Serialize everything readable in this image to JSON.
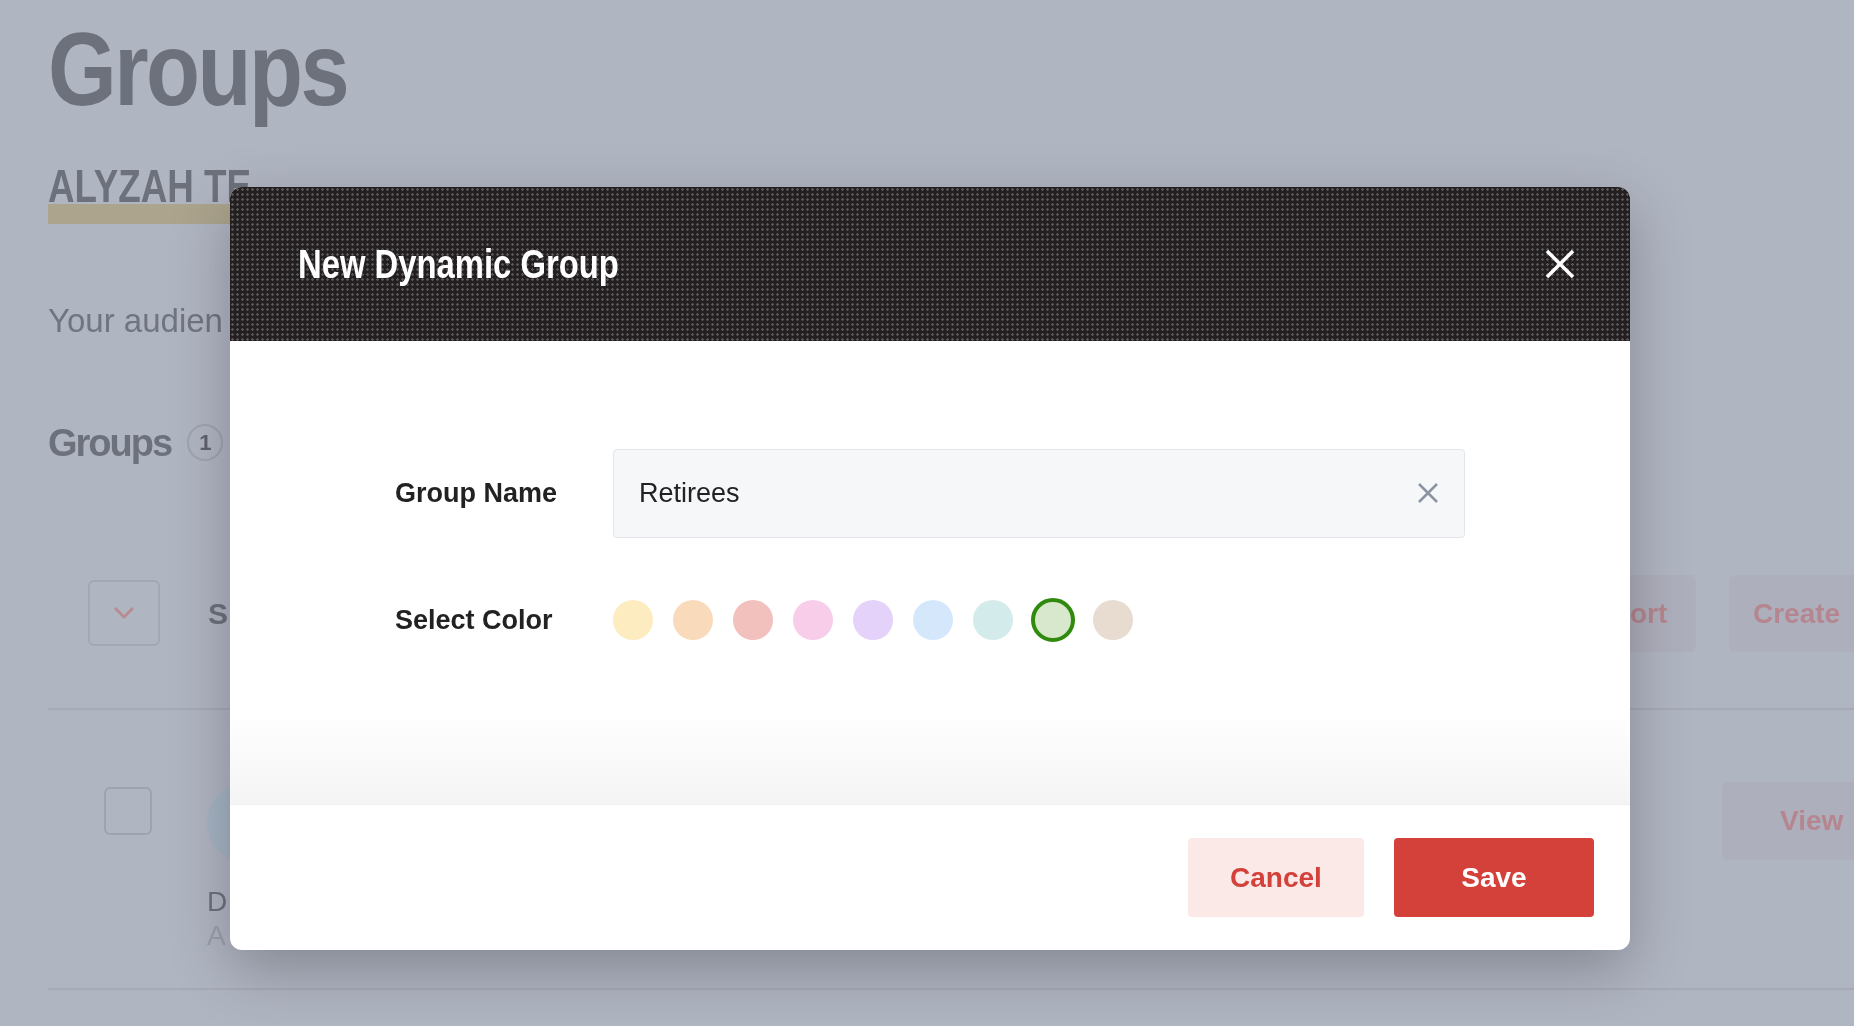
{
  "page": {
    "title": "Groups",
    "company": "ALYZAH TE",
    "intro": "Your audien",
    "section_title": "Groups",
    "count_badge": "1",
    "toolbar_text": "S",
    "toolbar_buttons": [
      "ort",
      "Create"
    ],
    "row": {
      "checked": false,
      "name": "D",
      "subtitle": "A",
      "action": "View"
    }
  },
  "dialog": {
    "title": "New Dynamic Group",
    "fields": [
      {
        "label": "Group Name",
        "value": "Retirees"
      }
    ],
    "color_label": "Select Color",
    "colors": [
      {
        "color": "#fcecbf",
        "selected": false
      },
      {
        "color": "#f9dbbb",
        "selected": false
      },
      {
        "color": "#f2c0bd",
        "selected": false
      },
      {
        "color": "#f7cdea",
        "selected": false
      },
      {
        "color": "#e4d2fa",
        "selected": false
      },
      {
        "color": "#d5e8fb",
        "selected": false
      },
      {
        "color": "#d3ebea",
        "selected": false
      },
      {
        "color": "#d8e8cd",
        "selected": true
      },
      {
        "color": "#e8dbcf",
        "selected": false
      }
    ],
    "buttons": [
      {
        "label": "Cancel",
        "kind": "secondary"
      },
      {
        "label": "Save",
        "kind": "primary"
      }
    ]
  }
}
